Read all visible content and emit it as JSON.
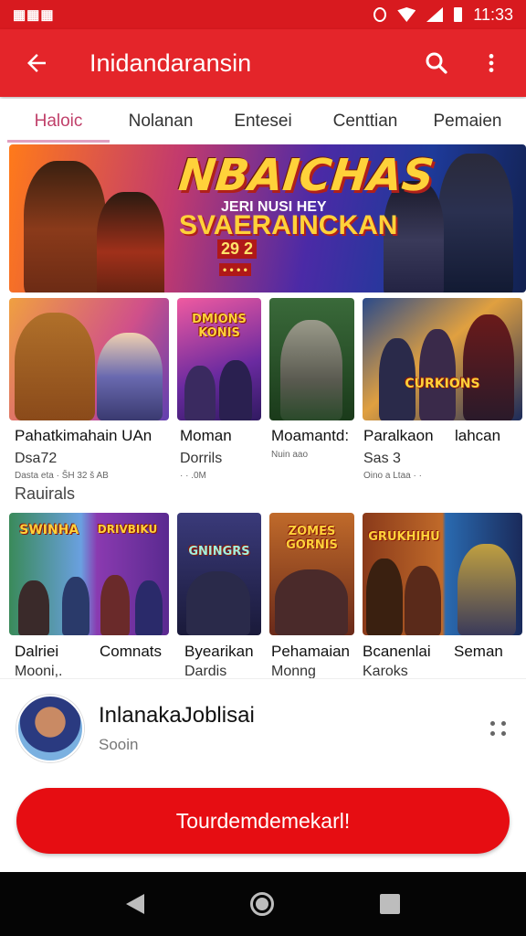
{
  "status_bar": {
    "left_icon": "notification-icons",
    "time": "11:33"
  },
  "app_bar": {
    "title": "Inidandaransin",
    "back_icon": "arrow-left-icon",
    "search_icon": "search-icon",
    "more_icon": "more-vert-icon"
  },
  "tabs": [
    {
      "label": "Haloic"
    },
    {
      "label": "Nolanan"
    },
    {
      "label": "Entesei"
    },
    {
      "label": "Centtian"
    },
    {
      "label": "Pemaien"
    }
  ],
  "banner": {
    "title": "NBAICHAS",
    "line1": "JERI NUSI HEY",
    "line2": "SVAERAINCKAN",
    "line3": "29 2",
    "line4": "• • • •"
  },
  "row1": [
    {
      "name": "Pahatkimahain UAn",
      "sub": "Dsa72",
      "meta": "Dasta eta ·  ŠH 32 š AB"
    },
    {
      "name": "Moman",
      "sub": "Dorrils",
      "meta": "· ·  .0M"
    },
    {
      "name": "Moamantd:",
      "sub": "",
      "meta": "Nuin    aao"
    },
    {
      "name": "Paralkaon",
      "sub": "Sas 3",
      "meta": "Oino a Ltaa · ·"
    },
    {
      "name": "lahcan",
      "sub": "",
      "meta": ""
    }
  ],
  "row1_logos": [
    "",
    "DMIONS KONIS",
    "",
    "CURKIONS",
    ""
  ],
  "section_title": "Rauirals",
  "row2": [
    {
      "name": "Dalriei",
      "sub": "Mooni,."
    },
    {
      "name": "Comnats",
      "sub": ""
    },
    {
      "name": "Byearikan",
      "sub": "Dardis"
    },
    {
      "name": "Pehamaian",
      "sub": "Monng"
    },
    {
      "name": "Bcanenlai",
      "sub": "Karoks"
    },
    {
      "name": "Seman",
      "sub": ""
    }
  ],
  "row2_logos": [
    "SWINHA",
    "DRIVBIKU",
    "GNINGRS",
    "ZOMES GORNIS",
    "GRUKHIHU",
    ""
  ],
  "now_playing": {
    "title": "InlanakaJoblisai",
    "subtitle": "Sooin",
    "more_icon": "drag-handle-icon"
  },
  "cta": {
    "label": "Tourdemdemekarl!"
  }
}
